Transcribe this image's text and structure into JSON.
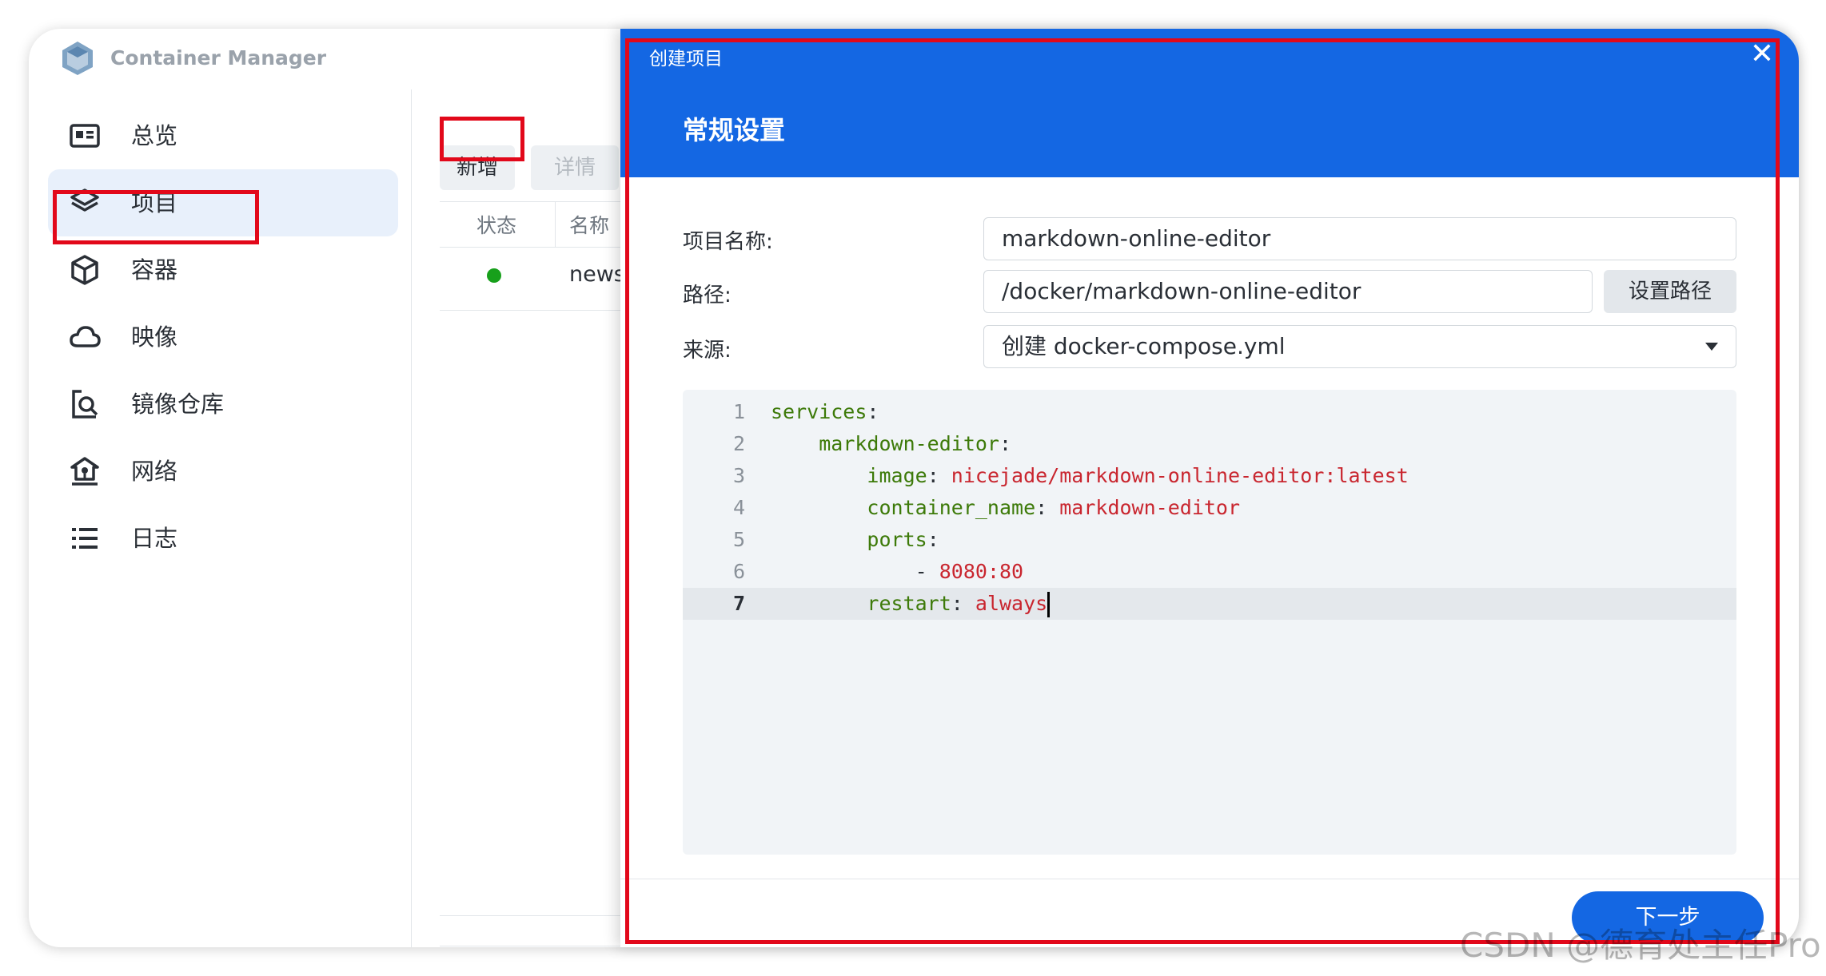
{
  "app": {
    "title": "Container Manager"
  },
  "sidebar": {
    "items": [
      {
        "label": "总览",
        "icon": "overview-icon"
      },
      {
        "label": "项目",
        "icon": "layers-icon",
        "active": true
      },
      {
        "label": "容器",
        "icon": "cube-icon"
      },
      {
        "label": "映像",
        "icon": "cloud-icon"
      },
      {
        "label": "镜像仓库",
        "icon": "registry-search-icon"
      },
      {
        "label": "网络",
        "icon": "network-home-icon"
      },
      {
        "label": "日志",
        "icon": "list-icon"
      }
    ]
  },
  "toolbar": {
    "add_label": "新增",
    "detail_label": "详情"
  },
  "table": {
    "columns": [
      "状态",
      "名称"
    ],
    "rows": [
      {
        "status": "running",
        "status_color": "#17a01b",
        "name": "news"
      }
    ]
  },
  "dialog": {
    "small_title": "创建项目",
    "title": "常规设置",
    "fields": {
      "project_name_label": "项目名称:",
      "project_name_value": "markdown-online-editor",
      "path_label": "路径:",
      "path_value": "/docker/markdown-online-editor",
      "set_path_label": "设置路径",
      "source_label": "来源:",
      "source_value": "创建 docker-compose.yml"
    },
    "editor": {
      "lines": [
        {
          "n": "1",
          "key": "services",
          "sep": ":",
          "val": ""
        },
        {
          "n": "2",
          "key": "markdown-editor",
          "sep": ":",
          "val": ""
        },
        {
          "n": "3",
          "key": "image",
          "sep": ": ",
          "val": "nicejade/markdown-online-editor:latest"
        },
        {
          "n": "4",
          "key": "container_name",
          "sep": ": ",
          "val": "markdown-editor"
        },
        {
          "n": "5",
          "key": "ports",
          "sep": ":",
          "val": ""
        },
        {
          "n": "6",
          "key": "- ",
          "sep": "",
          "val": "8080:80"
        },
        {
          "n": "7",
          "key": "restart",
          "sep": ": ",
          "val": "always"
        }
      ],
      "current_line": 7
    },
    "next_label": "下一步"
  },
  "watermark": "CSDN @德育处主任Pro",
  "colors": {
    "accent": "#1467e3",
    "highlight": "#e2081a",
    "running": "#17a01b"
  }
}
